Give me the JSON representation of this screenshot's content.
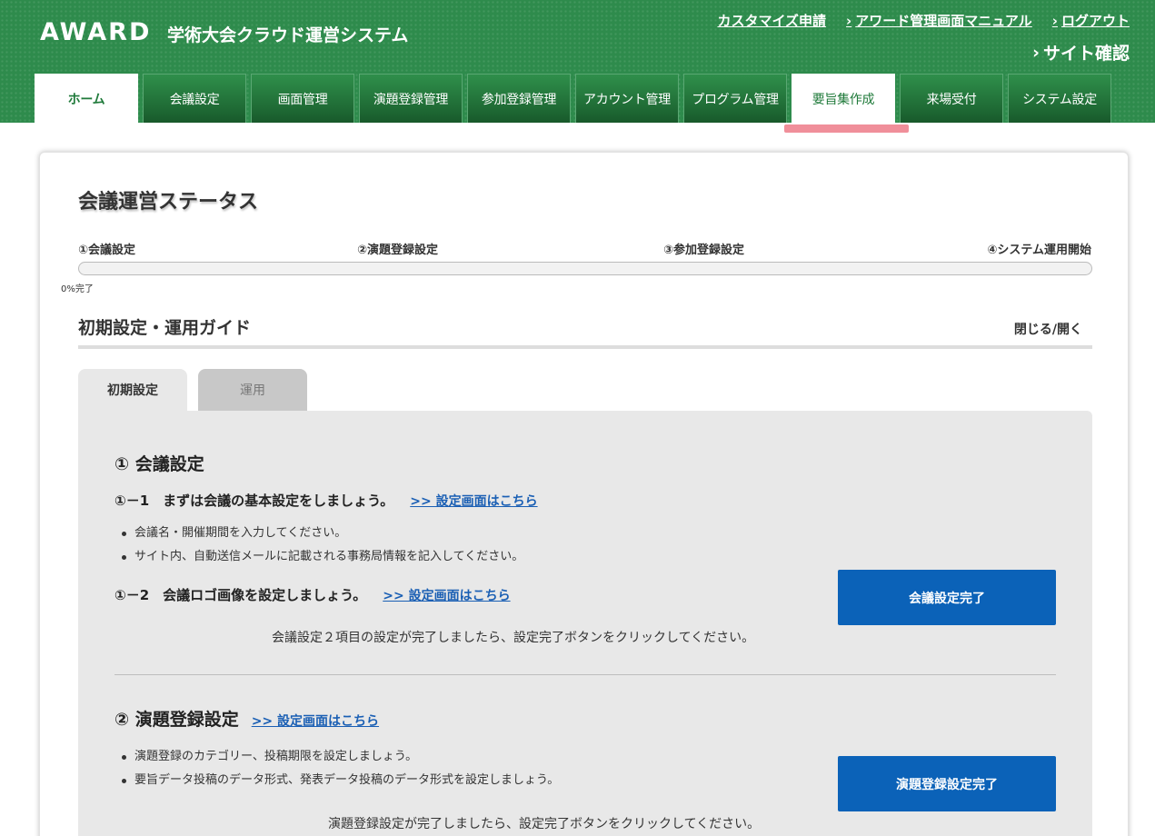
{
  "header": {
    "logo": "AWARD",
    "title": "学術大会クラウド運営システム",
    "links": [
      {
        "label": "カスタマイズ申請",
        "chevron": false
      },
      {
        "label": "アワード管理画面マニュアル",
        "chevron": true
      },
      {
        "label": "ログアウト",
        "chevron": true
      }
    ],
    "site_check": "サイト確認",
    "chevron_glyph": "›"
  },
  "nav": {
    "tabs": [
      "ホーム",
      "会議設定",
      "画面管理",
      "演題登録管理",
      "参加登録管理",
      "アカウント管理",
      "プログラム管理",
      "要旨集作成",
      "来場受付",
      "システム設定"
    ],
    "active_index": 0,
    "highlight_index": 7
  },
  "status": {
    "title": "会議運営ステータス",
    "steps": [
      "①会議設定",
      "②演題登録設定",
      "③参加登録設定",
      "④システム運用開始"
    ],
    "progress_value": 0,
    "progress_text": "0%完了"
  },
  "guide": {
    "title": "初期設定・運用ガイド",
    "toggle": "閉じる/開く",
    "tabs": [
      "初期設定",
      "運用"
    ],
    "section1": {
      "title": "① 会議設定",
      "sub1": {
        "label": "①－1　まずは会議の基本設定をしましょう。",
        "link": ">> 設定画面はこちら"
      },
      "bullets": [
        "会議名・開催期間を入力してください。",
        "サイト内、自動送信メールに記載される事務局情報を記入してください。"
      ],
      "sub2": {
        "label": "①－2　会議ロゴ画像を設定しましょう。",
        "link": ">> 設定画面はこちら"
      },
      "note": "会議設定２項目の設定が完了しましたら、設定完了ボタンをクリックしてください。",
      "button": "会議設定完了"
    },
    "section2": {
      "title": "② 演題登録設定",
      "link": ">> 設定画面はこちら",
      "bullets": [
        "演題登録のカテゴリー、投稿期限を設定しましょう。",
        "要旨データ投稿のデータ形式、発表データ投稿のデータ形式を設定しましょう。"
      ],
      "note": "演題登録設定が完了しましたら、設定完了ボタンをクリックしてください。",
      "button": "演題登録設定完了"
    }
  },
  "colors": {
    "header_green": "#2e8b4c",
    "button_blue": "#0b62b8",
    "link_blue": "#1a5fb4",
    "highlight_pink": "#f08f9a"
  }
}
